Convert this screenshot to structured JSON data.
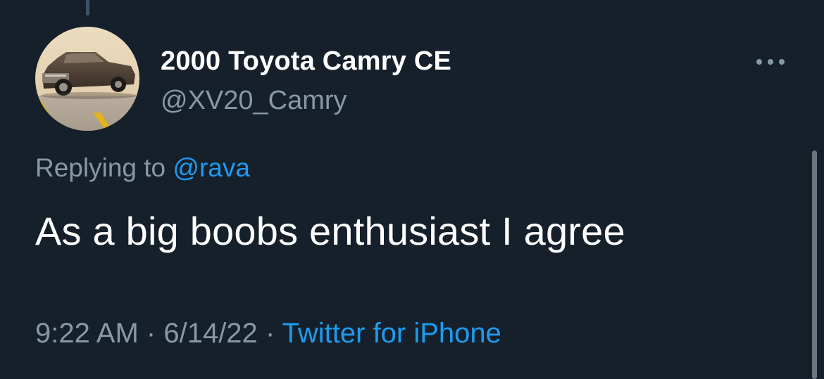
{
  "tweet": {
    "author_name": "2000 Toyota Camry CE",
    "author_handle": "@XV20_Camry",
    "avatar_icon": "car-photo-avatar",
    "more_icon": "more-horizontal-icon",
    "replying_prefix": "Replying to",
    "replying_to": "@rava",
    "text": "As a big boobs enthusiast I agree",
    "time": "9:22 AM",
    "separator": "·",
    "date": "6/14/22",
    "source": "Twitter for iPhone"
  },
  "colors": {
    "background": "#15202b",
    "primary_text": "#ffffff",
    "secondary_text": "#8899a6",
    "accent": "#1d9bf0"
  }
}
